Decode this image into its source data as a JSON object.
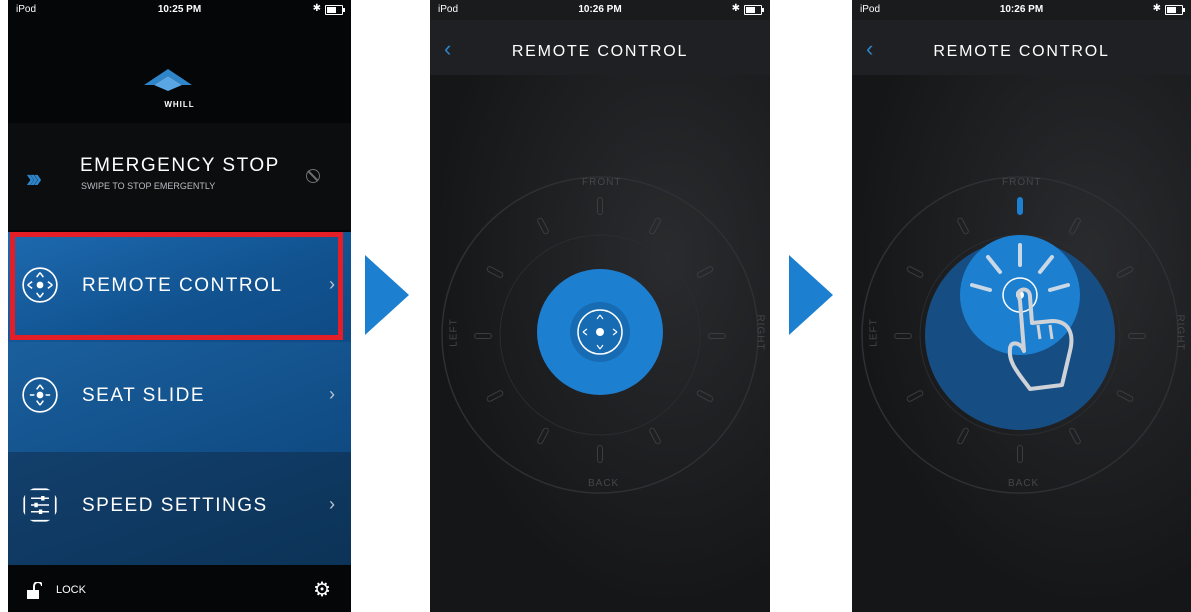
{
  "screen1": {
    "status": {
      "carrier": "iPod",
      "time": "10:25 PM"
    },
    "logo_text": "WHILL",
    "emergency": {
      "title": "EMERGENCY STOP",
      "subtitle": "SWIPE TO STOP EMERGENTLY"
    },
    "menu": [
      {
        "label": "REMOTE CONTROL",
        "icon": "joystick-icon",
        "highlighted": true
      },
      {
        "label": "SEAT SLIDE",
        "icon": "seat-slide-icon"
      },
      {
        "label": "SPEED SETTINGS",
        "icon": "sliders-icon"
      }
    ],
    "lock_label": "LOCK"
  },
  "screen2": {
    "status": {
      "carrier": "iPod",
      "time": "10:26 PM"
    },
    "title": "REMOTE CONTROL",
    "directions": {
      "front": "FRONT",
      "back": "BACK",
      "left": "LEFT",
      "right": "RIGHT"
    }
  },
  "screen3": {
    "status": {
      "carrier": "iPod",
      "time": "10:26 PM"
    },
    "title": "REMOTE CONTROL",
    "directions": {
      "front": "FRONT",
      "back": "BACK",
      "left": "LEFT",
      "right": "RIGHT"
    }
  },
  "colors": {
    "accent": "#1d7fd0",
    "highlight_border": "#e41e26",
    "menu_blue": "#11528f"
  }
}
